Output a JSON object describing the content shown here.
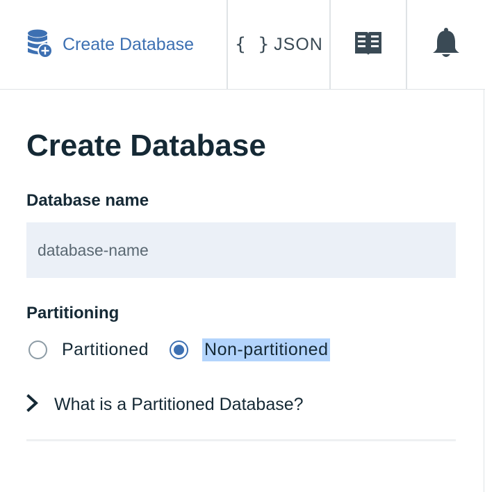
{
  "toolbar": {
    "create_label": "Create Database",
    "json_braces": "{ }",
    "json_label": "JSON",
    "docs_icon": "book-icon",
    "notifications_icon": "bell-icon",
    "accent_color": "#3d70b2"
  },
  "form": {
    "title": "Create Database",
    "name_label": "Database name",
    "name_placeholder": "database-name",
    "name_value": "",
    "partitioning_label": "Partitioning",
    "options": [
      {
        "label": "Partitioned",
        "selected": false
      },
      {
        "label": "Non-partitioned",
        "selected": true
      }
    ],
    "help_toggle_label": "What is a Partitioned Database?",
    "help_expanded": false
  }
}
